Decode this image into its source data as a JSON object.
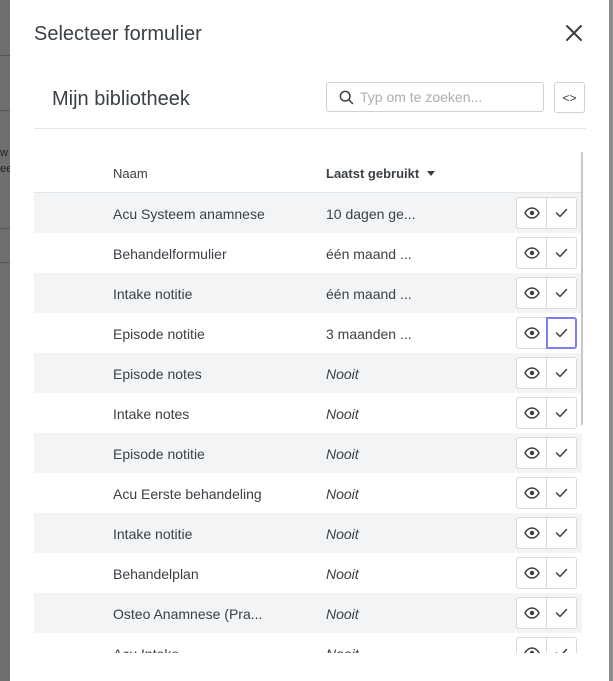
{
  "background": {
    "fragments": [
      "w",
      "ee"
    ]
  },
  "dialog": {
    "title": "Selecteer formulier",
    "library_title": "Mijn bibliotheek",
    "search": {
      "placeholder": "Typ om te zoeken...",
      "value": ""
    },
    "code_button_label": "<>",
    "icons": {
      "close": "close-icon",
      "search": "search-icon",
      "view": "eye-icon",
      "select": "check-icon",
      "sort": "caret-down-icon"
    },
    "focus_color": "#7b7ff3"
  },
  "table": {
    "columns": {
      "name": "Naam",
      "last_used": "Laatst gebruikt"
    },
    "sort": {
      "column": "last_used",
      "direction": "desc"
    },
    "rows": [
      {
        "name": "Acu Systeem anamnese",
        "last_used": "10 dagen ge...",
        "never": false
      },
      {
        "name": "Behandelformulier",
        "last_used": "één maand ...",
        "never": false
      },
      {
        "name": "Intake notitie",
        "last_used": "één maand ...",
        "never": false
      },
      {
        "name": "Episode notitie",
        "last_used": "3 maanden ...",
        "never": false
      },
      {
        "name": "Episode notes",
        "last_used": "Nooit",
        "never": true
      },
      {
        "name": "Intake notes",
        "last_used": "Nooit",
        "never": true
      },
      {
        "name": "Episode notitie",
        "last_used": "Nooit",
        "never": true
      },
      {
        "name": "Acu Eerste behandeling",
        "last_used": "Nooit",
        "never": true
      },
      {
        "name": "Intake notitie",
        "last_used": "Nooit",
        "never": true
      },
      {
        "name": "Behandelplan",
        "last_used": "Nooit",
        "never": true
      },
      {
        "name": "Osteo Anamnese (Pra...",
        "last_used": "Nooit",
        "never": true
      },
      {
        "name": "Acu Intake",
        "last_used": "Nooit",
        "never": true
      }
    ],
    "focused_select_row": 3
  }
}
